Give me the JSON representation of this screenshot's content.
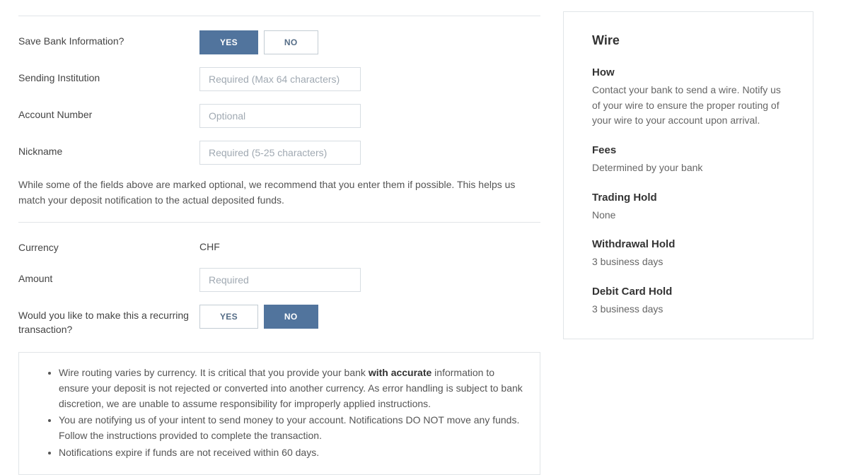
{
  "form": {
    "save_bank_label": "Save Bank Information?",
    "save_bank_yes": "YES",
    "save_bank_no": "NO",
    "sending_institution_label": "Sending Institution",
    "sending_institution_placeholder": "Required (Max 64 characters)",
    "account_number_label": "Account Number",
    "account_number_placeholder": "Optional",
    "nickname_label": "Nickname",
    "nickname_placeholder": "Required (5-25 characters)",
    "optional_info": "While some of the fields above are marked optional, we recommend that you enter them if possible. This helps us match your deposit notification to the actual deposited funds.",
    "currency_label": "Currency",
    "currency_value": "CHF",
    "amount_label": "Amount",
    "amount_placeholder": "Required",
    "recurring_label": "Would you like to make this a recurring transaction?",
    "recurring_yes": "YES",
    "recurring_no": "NO"
  },
  "notices": {
    "item1_pre": "Wire routing varies by currency. It is critical that you provide your bank ",
    "item1_bold": "with accurate",
    "item1_post": " information to ensure your deposit is not rejected or converted into another currency. As error handling is subject to bank discretion, we are unable to assume responsibility for improperly applied instructions.",
    "item2": "You are notifying us of your intent to send money to your account. Notifications DO NOT move any funds. Follow the instructions provided to complete the transaction.",
    "item3": "Notifications expire if funds are not received within 60 days."
  },
  "sidebar": {
    "title": "Wire",
    "how_heading": "How",
    "how_text": "Contact your bank to send a wire. Notify us of your wire to ensure the proper routing of your wire to your account upon arrival.",
    "fees_heading": "Fees",
    "fees_text": "Determined by your bank",
    "trading_hold_heading": "Trading Hold",
    "trading_hold_text": "None",
    "withdrawal_hold_heading": "Withdrawal Hold",
    "withdrawal_hold_text": "3 business days",
    "debit_hold_heading": "Debit Card Hold",
    "debit_hold_text": "3 business days"
  }
}
